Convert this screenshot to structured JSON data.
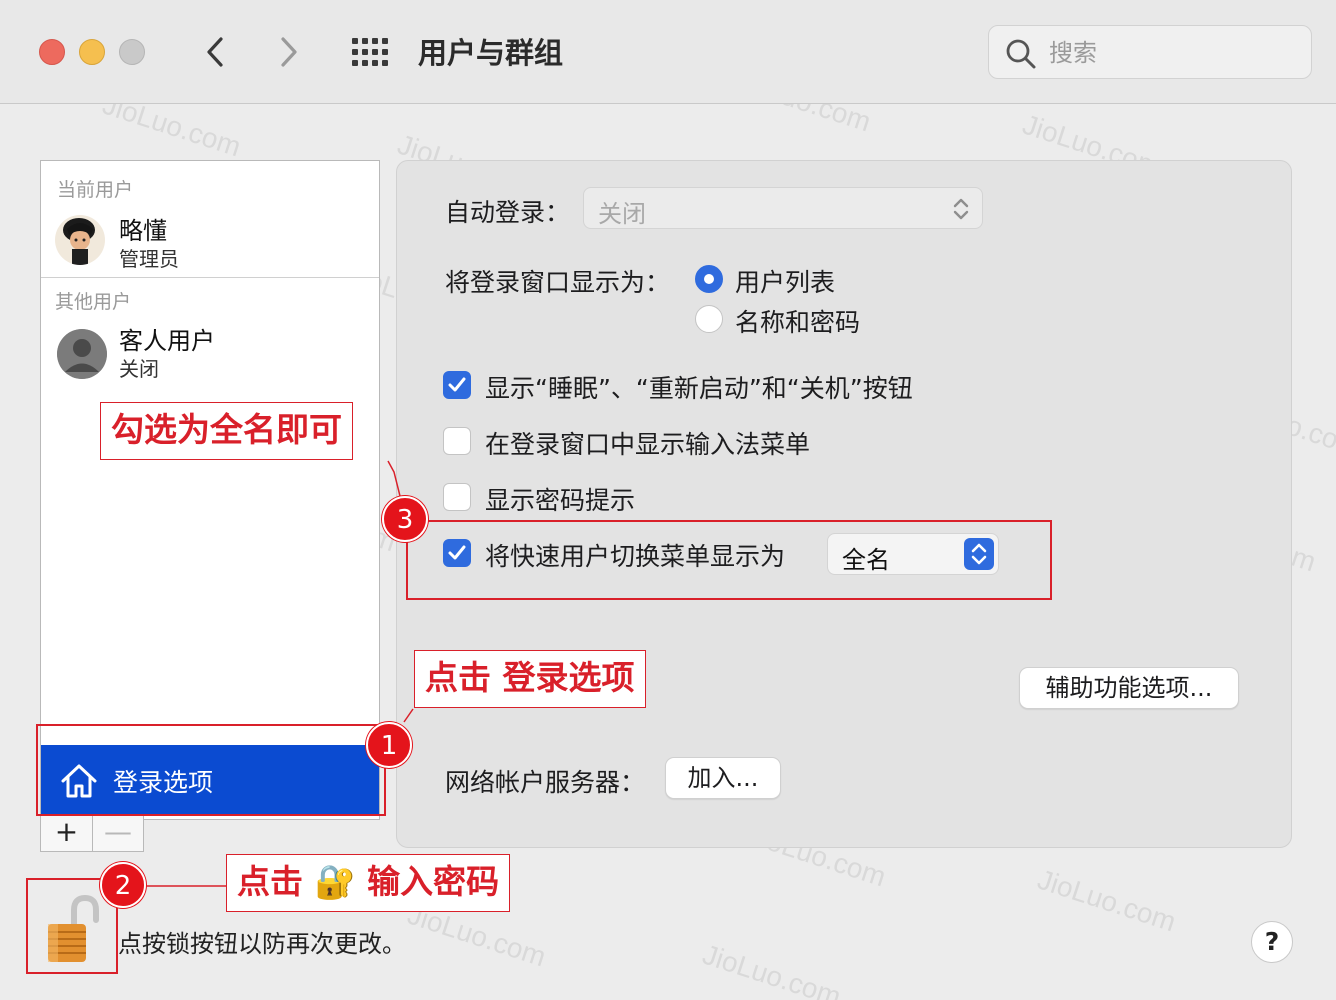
{
  "window": {
    "title": "用户与群组",
    "search_placeholder": "搜索"
  },
  "sidebar": {
    "current_users_label": "当前用户",
    "current_user": {
      "name": "略懂",
      "role": "管理员"
    },
    "other_users_label": "其他用户",
    "other_user": {
      "name": "客人用户",
      "status": "关闭"
    },
    "login_options_label": "登录选项",
    "add_label": "+",
    "remove_label": "—"
  },
  "settings": {
    "auto_login_label": "自动登录：",
    "auto_login_value": "关闭",
    "login_window_label": "将登录窗口显示为：",
    "radio_options": [
      {
        "label": "用户列表",
        "selected": true
      },
      {
        "label": "名称和密码",
        "selected": false
      }
    ],
    "checkboxes": [
      {
        "label": "显示“睡眠”、“重新启动”和“关机”按钮",
        "checked": true
      },
      {
        "label": "在登录窗口中显示输入法菜单",
        "checked": false
      },
      {
        "label": "显示密码提示",
        "checked": false
      },
      {
        "label": "将快速用户切换菜单显示为",
        "checked": true
      }
    ],
    "fast_switch_value": "全名",
    "accessibility_button": "辅助功能选项...",
    "network_server_label": "网络帐户服务器：",
    "join_button": "加入..."
  },
  "footer": {
    "lock_text": "点按锁按钮以防再次更改。",
    "help_label": "?"
  },
  "annotations": [
    {
      "number": "1",
      "text": "点击 登录选项"
    },
    {
      "number": "2",
      "text": "点击 🔐 输入密码"
    },
    {
      "number": "3",
      "text": "勾选为全名即可"
    }
  ],
  "watermark": "JioLuo.com",
  "colors": {
    "accent": "#2f6bde",
    "selection": "#0b4bd1",
    "annotation": "#d9202a"
  }
}
